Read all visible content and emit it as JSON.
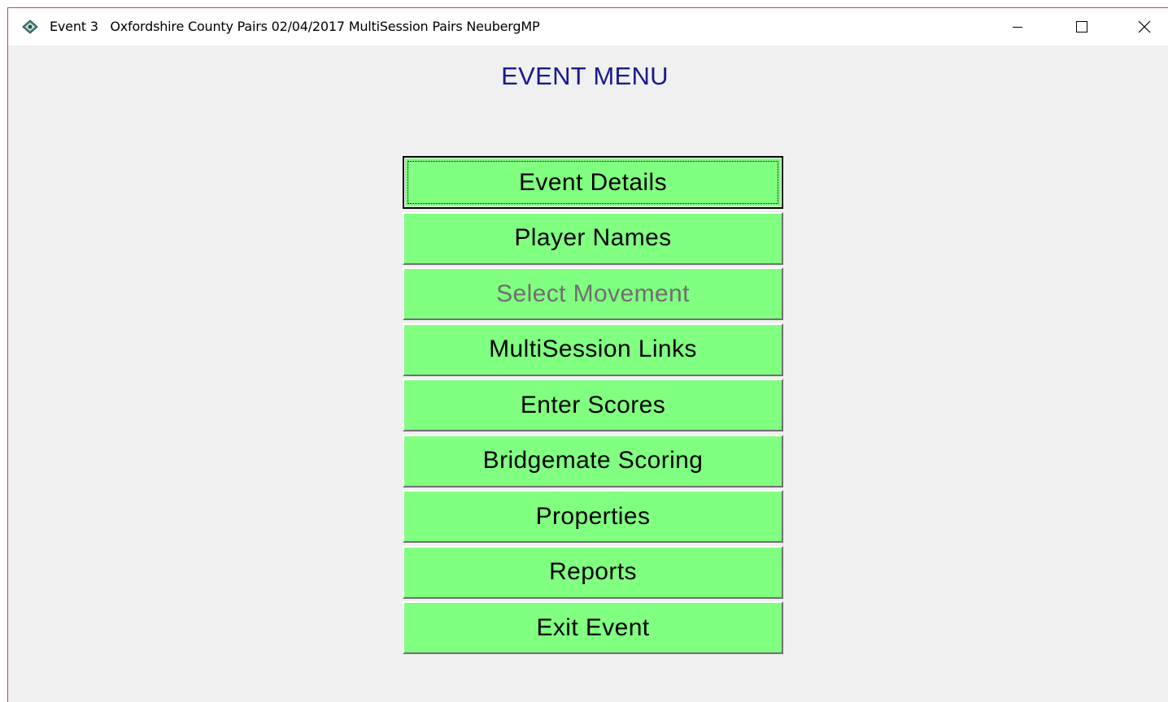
{
  "window": {
    "title": "Event 3   Oxfordshire County Pairs 02/04/2017 MultiSession Pairs NeubergMP",
    "app_icon": "bridge-app-icon",
    "controls": {
      "minimize": "minimize-icon",
      "maximize": "maximize-icon",
      "close": "close-icon"
    }
  },
  "heading": "EVENT MENU",
  "menu": {
    "items": [
      {
        "label": "Event Details",
        "state": "focused"
      },
      {
        "label": "Player Names",
        "state": "normal"
      },
      {
        "label": "Select Movement",
        "state": "disabled"
      },
      {
        "label": "MultiSession Links",
        "state": "normal"
      },
      {
        "label": "Enter Scores",
        "state": "normal"
      },
      {
        "label": "Bridgemate Scoring",
        "state": "normal"
      },
      {
        "label": "Properties",
        "state": "normal"
      },
      {
        "label": "Reports",
        "state": "normal"
      },
      {
        "label": "Exit Event",
        "state": "normal"
      }
    ]
  },
  "colors": {
    "button_bg": "#80ff80",
    "heading": "#1a1a8c",
    "disabled_text": "#6f6f6f",
    "window_bg": "#f0f0f0"
  }
}
